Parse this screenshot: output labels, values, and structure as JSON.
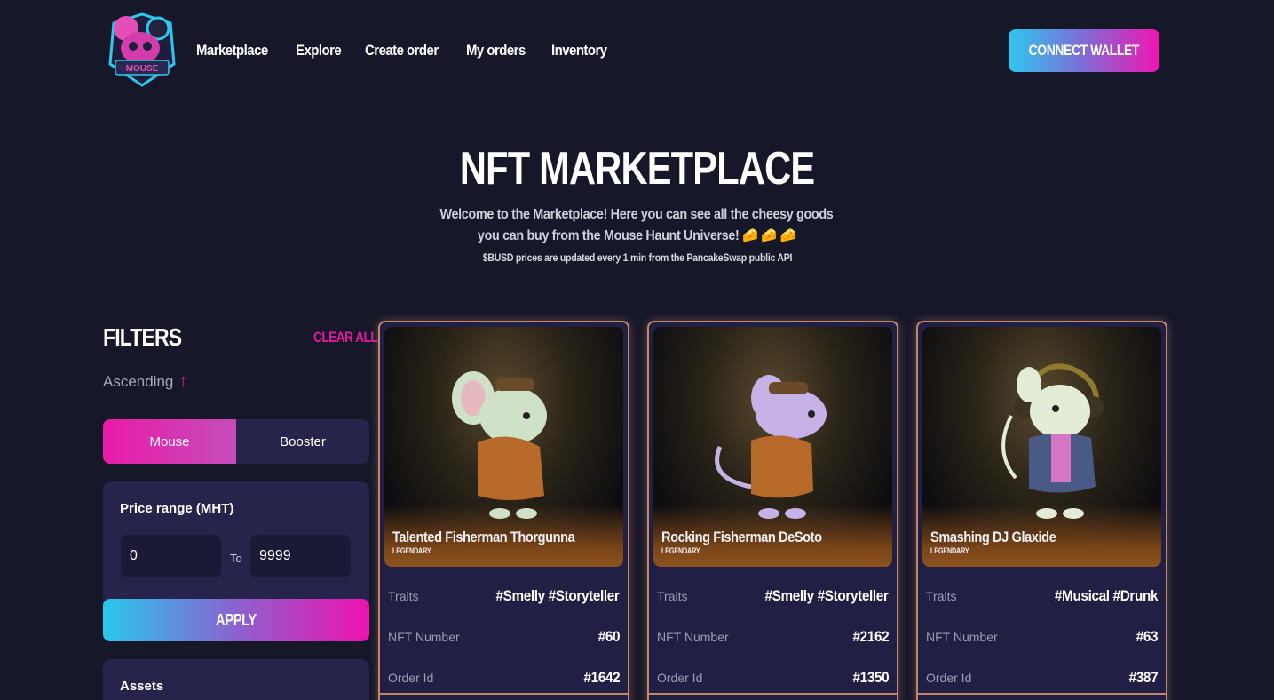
{
  "header": {
    "nav": [
      "Marketplace",
      "Explore",
      "Create order",
      "My orders",
      "Inventory"
    ],
    "connect_label": "CONNECT WALLET"
  },
  "hero": {
    "title": "NFT MARKETPLACE",
    "subtitle": "Welcome to the Marketplace! Here you can see all the cheesy goods you can buy from the Mouse Haunt Universe! 🧀 🧀 🧀",
    "note": "$BUSD prices are updated every 1 min from the PancakeSwap public API"
  },
  "filters": {
    "title": "FILTERS",
    "clear_all": "CLEAR ALL",
    "sort_label": "Ascending",
    "toggle": [
      "Mouse",
      "Booster"
    ],
    "price_label": "Price range (MHT)",
    "price_min": "0",
    "price_to": "To",
    "price_max": "9999",
    "apply_label": "APPLY",
    "assets_label": "Assets"
  },
  "cards": [
    {
      "name": "Talented Fisherman Thorgunna",
      "rarity": "LEGENDARY",
      "traits_label": "Traits",
      "traits": "#Smelly  #Storyteller",
      "nft_label": "NFT Number",
      "nft_number": "#60",
      "order_label": "Order Id",
      "order_id": "#1642",
      "body_color": "#cfe2c8",
      "outfit": "plaid"
    },
    {
      "name": "Rocking Fisherman DeSoto",
      "rarity": "LEGENDARY",
      "traits_label": "Traits",
      "traits": "#Smelly  #Storyteller",
      "nft_label": "NFT Number",
      "nft_number": "#2162",
      "order_label": "Order Id",
      "order_id": "#1350",
      "body_color": "#c6b2e6",
      "outfit": "plaid"
    },
    {
      "name": "Smashing DJ Glaxide",
      "rarity": "LEGENDARY",
      "traits_label": "Traits",
      "traits": "#Musical  #Drunk",
      "nft_label": "NFT Number",
      "nft_number": "#63",
      "order_label": "Order Id",
      "order_id": "#387",
      "body_color": "#e3ecd6",
      "outfit": "jacket"
    }
  ],
  "colors": {
    "background": "#161729",
    "accent_pink": "#e3199f",
    "accent_cyan": "#2ec7ee",
    "card_border": "#c48768",
    "panel": "#26244a"
  }
}
